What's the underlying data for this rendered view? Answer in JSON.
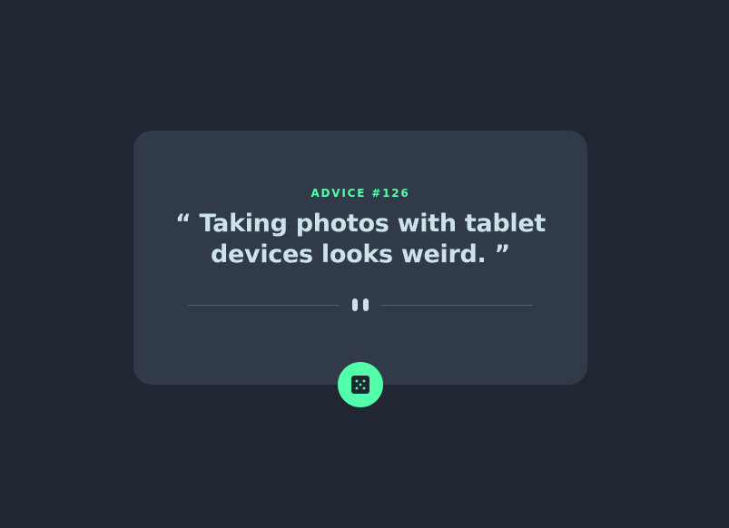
{
  "advice": {
    "id_label": "ADVICE #126",
    "quote": "“ Taking photos with tablet devices looks weird. ”"
  },
  "divider": {
    "icon": "pause-icon"
  },
  "dice_button": {
    "icon": "dice-icon"
  },
  "colors": {
    "background": "#202733",
    "card": "#313a49",
    "accent": "#53ffaa",
    "text": "#cee3e9",
    "divider_line": "#4f5d74"
  }
}
